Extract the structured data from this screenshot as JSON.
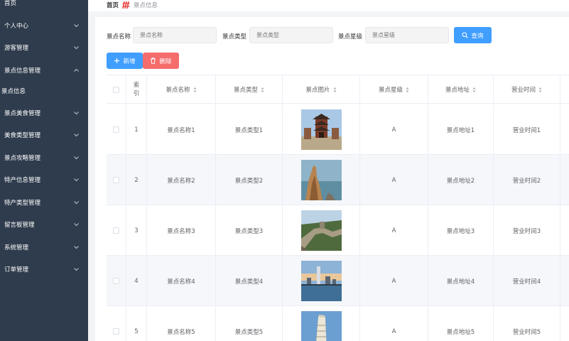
{
  "sidebar": {
    "items": [
      {
        "label": "首页",
        "chevron": false
      },
      {
        "label": "个人中心",
        "chevron": true
      },
      {
        "label": "游客管理",
        "chevron": true
      },
      {
        "label": "景点信息管理",
        "chevron": true,
        "open": true
      },
      {
        "label": "景点信息",
        "chevron": false,
        "sub": true
      },
      {
        "label": "景点美食管理",
        "chevron": true
      },
      {
        "label": "美食类型管理",
        "chevron": true
      },
      {
        "label": "景点攻略管理",
        "chevron": true
      },
      {
        "label": "特产信息管理",
        "chevron": true
      },
      {
        "label": "特产类型管理",
        "chevron": true
      },
      {
        "label": "留言板管理",
        "chevron": true
      },
      {
        "label": "系统管理",
        "chevron": true
      },
      {
        "label": "订单管理",
        "chevron": true
      }
    ],
    "colors": {
      "bg": "#2f3c4d",
      "text": "#ffffff"
    }
  },
  "breadcrumb": {
    "home": "首页",
    "separator_icon": "decorative-logo-icon",
    "current": "景点信息"
  },
  "filters": {
    "name_label": "景点名称",
    "name_placeholder": "景点名称",
    "type_label": "景点类型",
    "type_placeholder": "景点类型",
    "star_label": "景点星级",
    "star_placeholder": "景点星级",
    "search_label": "查询"
  },
  "actions": {
    "add_label": "新增",
    "delete_label": "删除"
  },
  "table": {
    "headers": [
      "索引",
      "景点名称",
      "景点类型",
      "景点图片",
      "景点星级",
      "景点地址",
      "营业时间"
    ],
    "rows": [
      {
        "index": "1",
        "name": "景点名称1",
        "type": "景点类型1",
        "image": "pagoda-gate",
        "star": "A",
        "address": "景点地址1",
        "hours": "营业时间1"
      },
      {
        "index": "2",
        "name": "景点名称2",
        "type": "景点类型2",
        "image": "rock-pillar",
        "star": "A",
        "address": "景点地址2",
        "hours": "营业时间2"
      },
      {
        "index": "3",
        "name": "景点名称3",
        "type": "景点类型3",
        "image": "great-wall",
        "star": "A",
        "address": "景点地址3",
        "hours": "营业时间3"
      },
      {
        "index": "4",
        "name": "景点名称4",
        "type": "景点类型4",
        "image": "city-skyline",
        "star": "A",
        "address": "景点地址4",
        "hours": "营业时间4"
      },
      {
        "index": "5",
        "name": "景点名称5",
        "type": "景点类型5",
        "image": "leaning-tower",
        "star": "A",
        "address": "景点地址5",
        "hours": "营业时间5"
      }
    ]
  },
  "colors": {
    "primary": "#409eff",
    "danger": "#f56c6c",
    "border": "#ebeef5",
    "stripe": "#f5f7fa"
  }
}
